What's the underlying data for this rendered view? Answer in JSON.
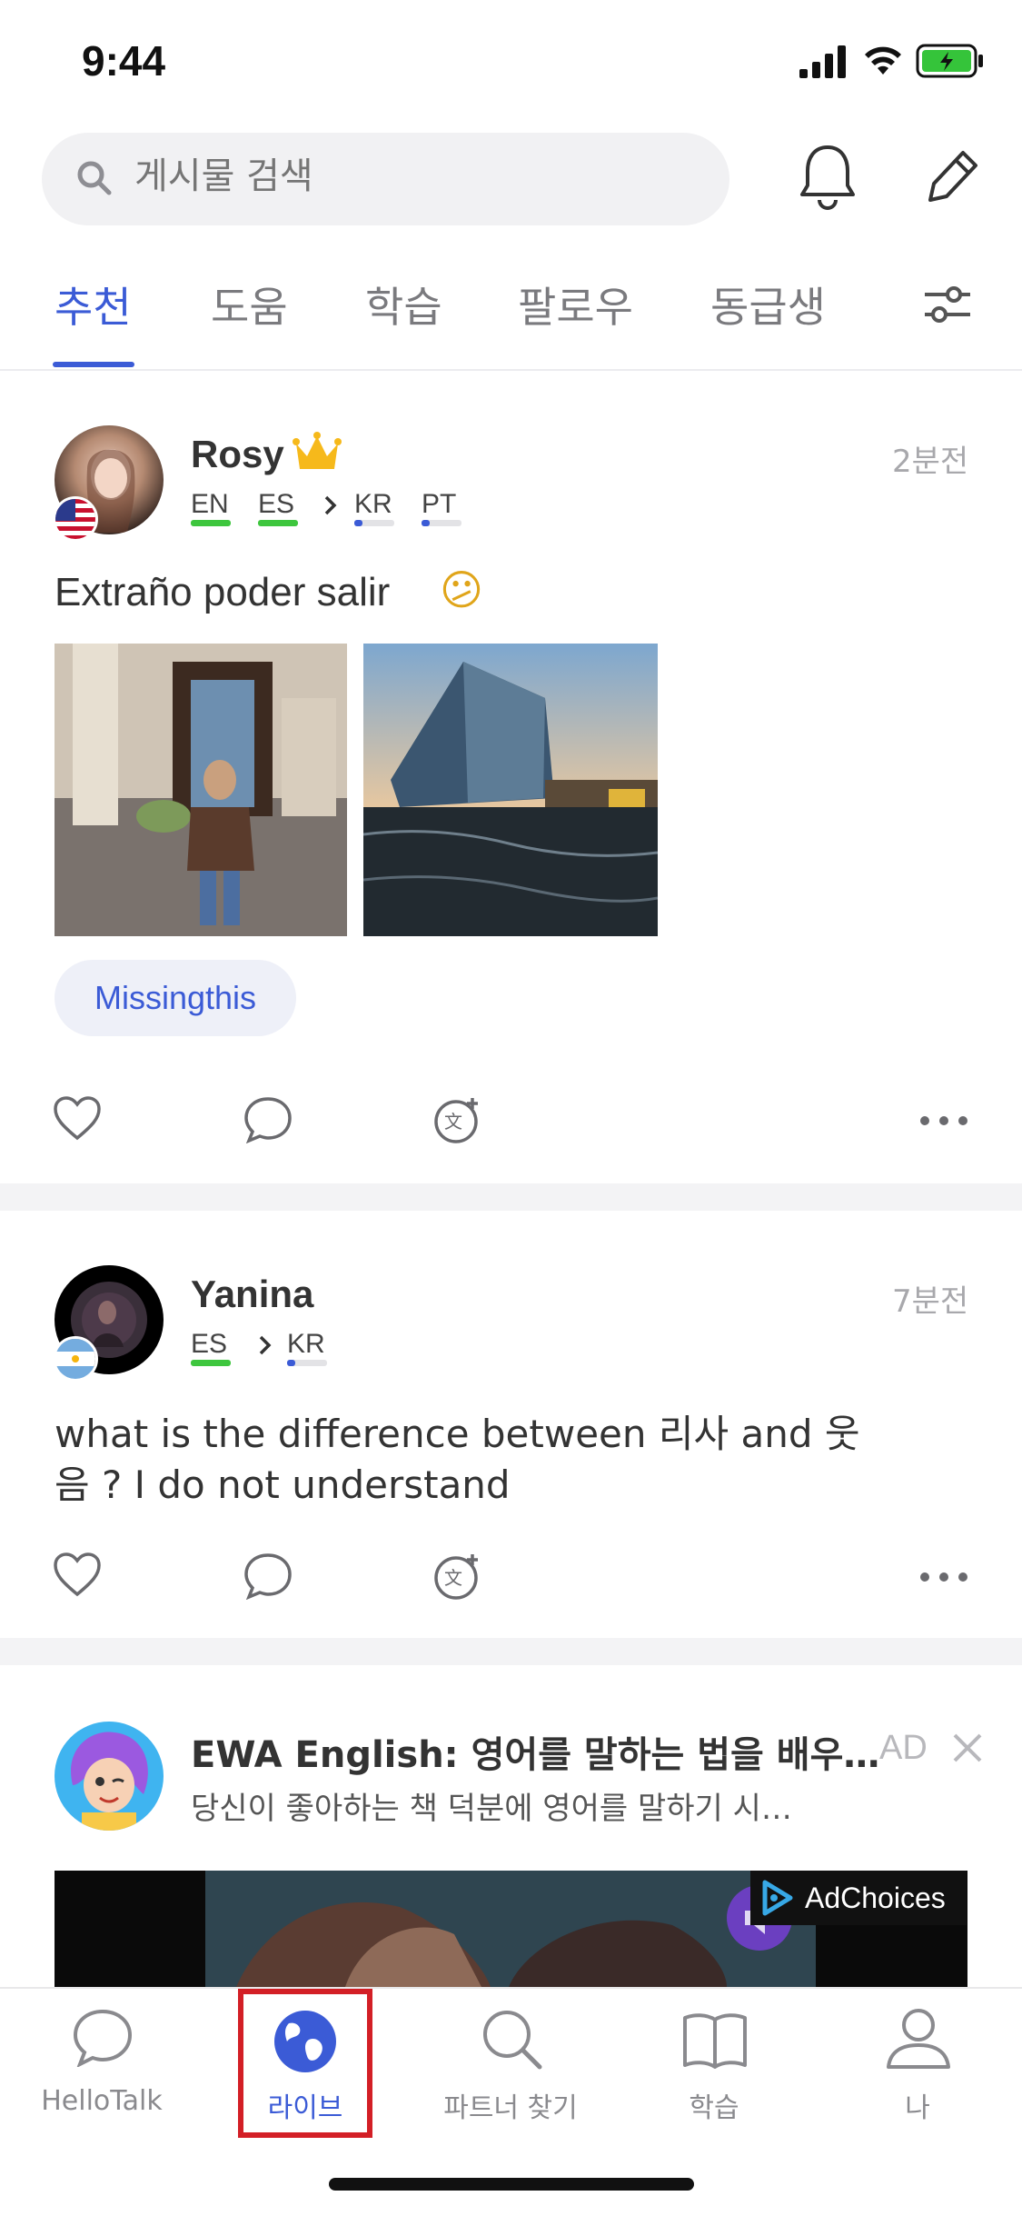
{
  "status_bar": {
    "time": "9:44"
  },
  "search": {
    "placeholder": "게시물 검색"
  },
  "tabs": [
    {
      "label": "추천",
      "active": true
    },
    {
      "label": "도움"
    },
    {
      "label": "학습"
    },
    {
      "label": "팔로우"
    },
    {
      "label": "동급생"
    }
  ],
  "posts": [
    {
      "username": "Rosy",
      "time": "2분전",
      "languages": [
        {
          "code": "EN",
          "level": 1.0,
          "color": "#3ec63e"
        },
        {
          "code": "ES",
          "level": 1.0,
          "color": "#3ec63e"
        },
        {
          "code": "KR",
          "level": 0.2,
          "color": "#3b5bd6"
        },
        {
          "code": "PT",
          "level": 0.2,
          "color": "#3b5bd6"
        }
      ],
      "text": "Extraño poder salir",
      "emoji": "😕",
      "tag": "Missingthis"
    },
    {
      "username": "Yanina",
      "time": "7분전",
      "languages": [
        {
          "code": "ES",
          "level": 1.0,
          "color": "#3ec63e"
        },
        {
          "code": "KR",
          "level": 0.2,
          "color": "#3b5bd6"
        }
      ],
      "text_line1": "what is the difference between  리사  and 웃",
      "text_line2": "음 ? I do not understand"
    }
  ],
  "ad": {
    "title": "EWA English: 영어를 말하는 법을 배우…",
    "subtitle": "당신이 좋아하는 책 덕분에 영어를 말하기 시…",
    "label": "AD",
    "adchoices": "AdChoices"
  },
  "bottom_nav": [
    {
      "label": "HelloTalk"
    },
    {
      "label": "라이브",
      "active": true
    },
    {
      "label": "파트너 찾기"
    },
    {
      "label": "학습"
    },
    {
      "label": "나"
    }
  ],
  "colors": {
    "accent": "#3b5bd6",
    "highlight_box": "#d31f26",
    "native_green": "#3ec63e"
  }
}
